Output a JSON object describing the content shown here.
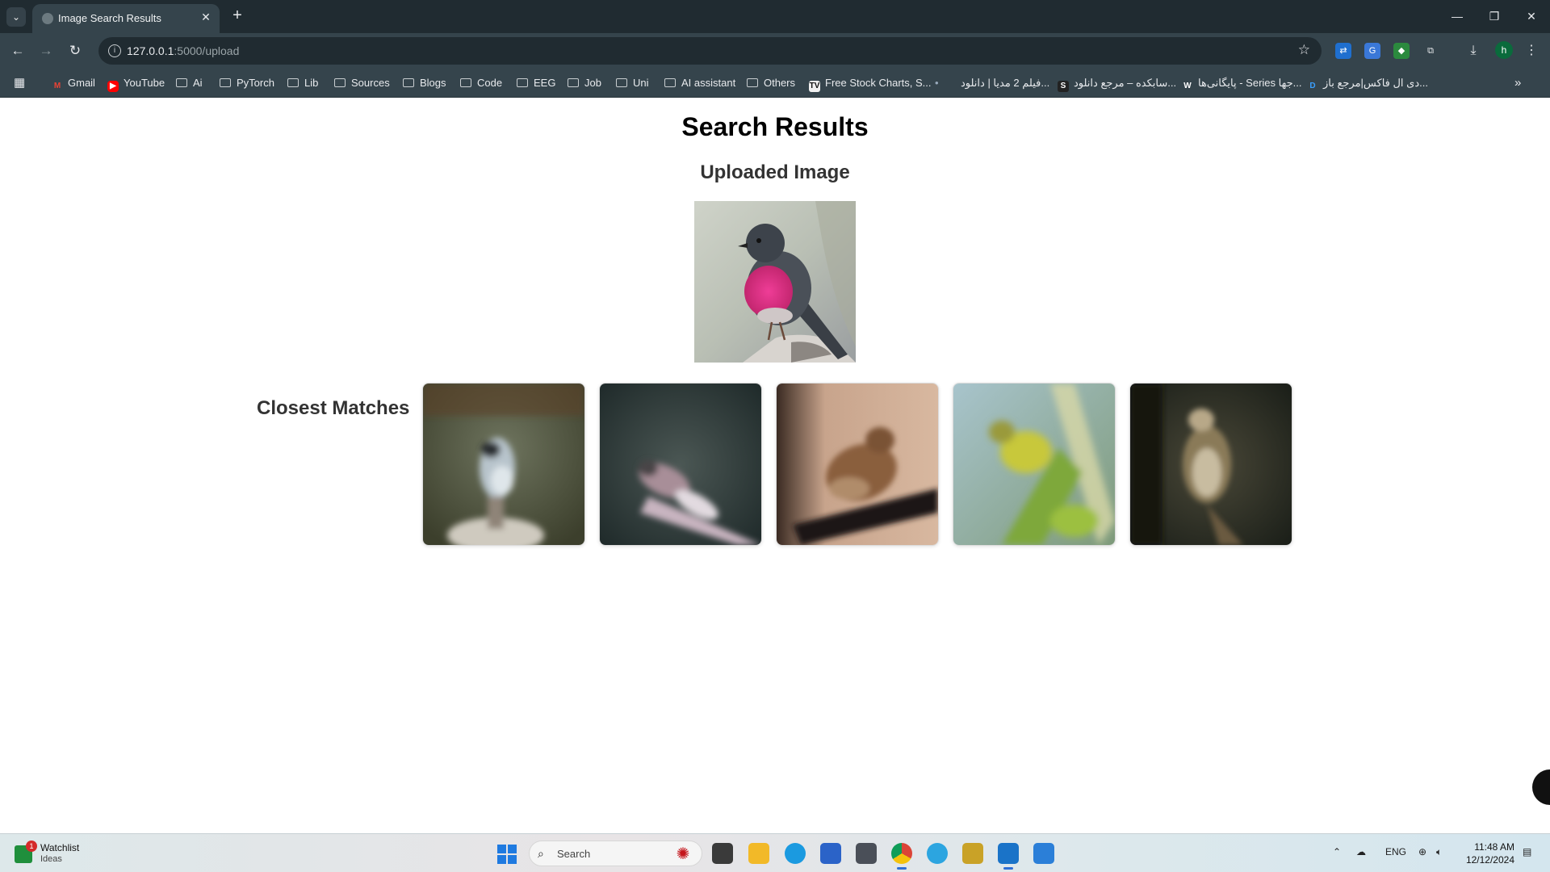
{
  "browser": {
    "tab_title": "Image Search Results",
    "url_host": "127.0.0.1",
    "url_path": ":5000/upload",
    "profile_initial": "h"
  },
  "bookmarks": [
    {
      "label": "Gmail",
      "kind": "gmail-icon"
    },
    {
      "label": "YouTube",
      "kind": "youtube-icon"
    },
    {
      "label": "Ai",
      "kind": "folder-icon"
    },
    {
      "label": "PyTorch",
      "kind": "folder-icon"
    },
    {
      "label": "Lib",
      "kind": "folder-icon"
    },
    {
      "label": "Sources",
      "kind": "folder-icon"
    },
    {
      "label": "Blogs",
      "kind": "folder-icon"
    },
    {
      "label": "Code",
      "kind": "folder-icon"
    },
    {
      "label": "EEG",
      "kind": "folder-icon"
    },
    {
      "label": "Job",
      "kind": "folder-icon"
    },
    {
      "label": "Uni",
      "kind": "folder-icon"
    },
    {
      "label": "AI assistant",
      "kind": "folder-icon"
    },
    {
      "label": "Others",
      "kind": "folder-icon"
    },
    {
      "label": "Free Stock Charts, S...",
      "kind": "tradingview-icon"
    },
    {
      "label": "فیلم 2 مدیا | دانلود...",
      "kind": "site-icon"
    },
    {
      "label": "سابکده – مرجع دانلود...",
      "kind": "site-icon"
    },
    {
      "label": "پایگانی‌ها - Series جها...",
      "kind": "site-icon"
    },
    {
      "label": "دی ال فاکس|مرجع باز...",
      "kind": "site-icon"
    }
  ],
  "page": {
    "title": "Search Results",
    "uploaded_heading": "Uploaded Image",
    "matches_heading": "Closest Matches"
  },
  "taskbar": {
    "widget_title": "Watchlist",
    "widget_subtitle": "Ideas",
    "widget_badge": "1",
    "search_placeholder": "Search",
    "language": "ENG",
    "time": "11:48 AM",
    "date": "12/12/2024"
  },
  "colors": {
    "chrome_dark": "#202b31",
    "chrome_mid": "#35444c",
    "accent_blue": "#2f6fd6"
  }
}
